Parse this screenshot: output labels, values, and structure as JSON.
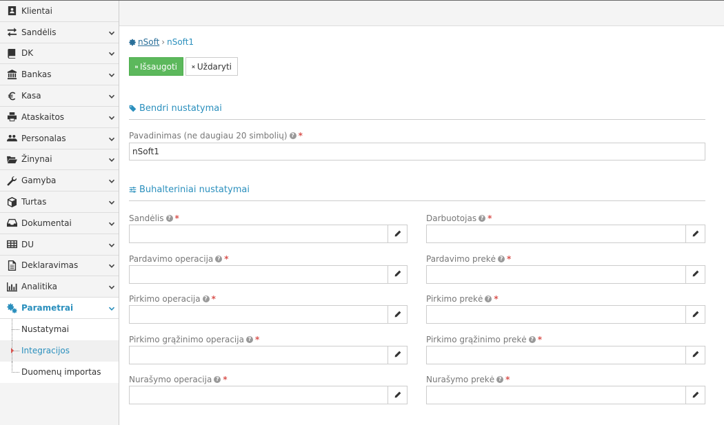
{
  "sidebar": {
    "items": [
      {
        "label": "Klientai",
        "icon": "address-card-icon",
        "has_chevron": false
      },
      {
        "label": "Sandėlis",
        "icon": "exchange-arrows-icon",
        "has_chevron": true
      },
      {
        "label": "DK",
        "icon": "book-icon",
        "has_chevron": true
      },
      {
        "label": "Bankas",
        "icon": "bank-building-icon",
        "has_chevron": true
      },
      {
        "label": "Kasa",
        "icon": "euro-icon",
        "has_chevron": true
      },
      {
        "label": "Ataskaitos",
        "icon": "printer-icon",
        "has_chevron": true
      },
      {
        "label": "Personalas",
        "icon": "users-icon",
        "has_chevron": true
      },
      {
        "label": "Žinynai",
        "icon": "folder-open-icon",
        "has_chevron": true
      },
      {
        "label": "Gamyba",
        "icon": "wrench-icon",
        "has_chevron": true
      },
      {
        "label": "Turtas",
        "icon": "cube-icon",
        "has_chevron": true
      },
      {
        "label": "Dokumentai",
        "icon": "inbox-icon",
        "has_chevron": true
      },
      {
        "label": "DU",
        "icon": "table-grid-icon",
        "has_chevron": true
      },
      {
        "label": "Deklaravimas",
        "icon": "document-icon",
        "has_chevron": true
      },
      {
        "label": "Analitika",
        "icon": "bar-chart-icon",
        "has_chevron": true
      },
      {
        "label": "Parametrai",
        "icon": "gears-icon",
        "has_chevron": true,
        "active": true
      }
    ],
    "sub_items": [
      {
        "label": "Nustatymai"
      },
      {
        "label": "Integracijos",
        "selected": true
      },
      {
        "label": "Duomenų importas"
      }
    ]
  },
  "breadcrumb": {
    "root": "nSoft",
    "separator": "›",
    "current": "nSoft1"
  },
  "toolbar": {
    "save_label": "Išsaugoti",
    "close_label": "Uždaryti"
  },
  "general": {
    "title": "Bendri nustatymai",
    "name_label": "Pavadinimas (ne daugiau 20 simbolių)",
    "name_value": "nSoft1"
  },
  "accounting": {
    "title": "Buhalteriniai nustatymai",
    "fields_left": [
      {
        "label": "Sandėlis",
        "value": ""
      },
      {
        "label": "Pardavimo operacija",
        "value": ""
      },
      {
        "label": "Pirkimo operacija",
        "value": ""
      },
      {
        "label": "Pirkimo grąžinimo operacija",
        "value": ""
      },
      {
        "label": "Nurašymo operacija",
        "value": ""
      }
    ],
    "fields_right": [
      {
        "label": "Darbuotojas",
        "value": ""
      },
      {
        "label": "Pardavimo prekė",
        "value": ""
      },
      {
        "label": "Pirkimo prekė",
        "value": ""
      },
      {
        "label": "Pirkimo grąžinimo prekė",
        "value": ""
      },
      {
        "label": "Nurašymo prekė",
        "value": ""
      }
    ]
  },
  "required_marker": "*",
  "colors": {
    "accent": "#2a8fbd",
    "save": "#5cb85c",
    "required": "#d9534f"
  }
}
